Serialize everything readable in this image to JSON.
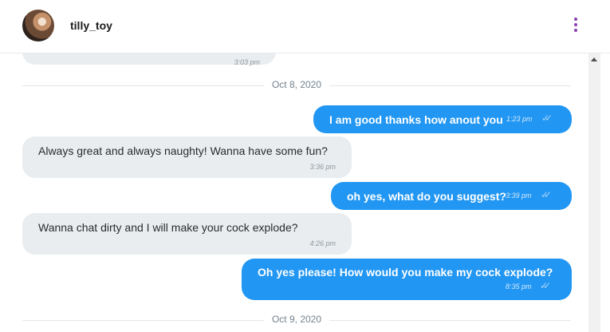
{
  "header": {
    "username": "tilly_toy"
  },
  "messages": {
    "partial_time": "3:03 pm",
    "date1": "Oct 8, 2020",
    "m1": {
      "text": "I am good thanks how anout you",
      "time": "1:23 pm"
    },
    "m2": {
      "text": "Always great and always naughty! Wanna have some fun?",
      "time": "3:36 pm"
    },
    "m3": {
      "text": "oh yes, what do you suggest?",
      "time": "3:39 pm"
    },
    "m4": {
      "text": "Wanna chat dirty and I will make your cock explode?",
      "time": "4:26 pm"
    },
    "m5": {
      "text": "Oh yes please! How would you make my cock explode?",
      "time": "8:35 pm"
    },
    "date2": "Oct 9, 2020"
  },
  "icons": {
    "read_receipt": "double-check-icon",
    "menu": "kebab-menu-icon"
  },
  "colors": {
    "outgoing_bubble": "#2196f3",
    "incoming_bubble": "#e9edf0",
    "menu_accent": "#8a3fb3"
  }
}
